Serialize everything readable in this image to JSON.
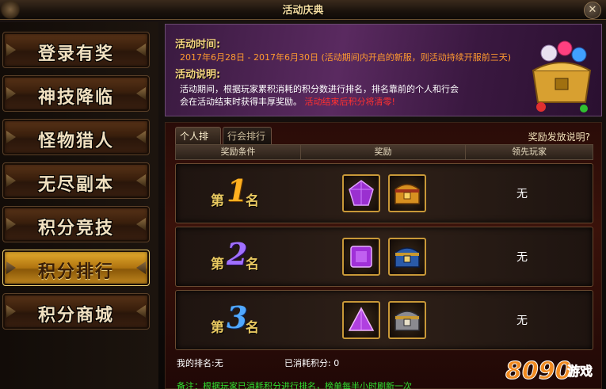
{
  "window": {
    "title": "活动庆典",
    "close_glyph": "✕"
  },
  "sidebar": {
    "items": [
      {
        "label": "登录有奖",
        "active": false
      },
      {
        "label": "神技降临",
        "active": false
      },
      {
        "label": "怪物猎人",
        "active": false
      },
      {
        "label": "无尽副本",
        "active": false
      },
      {
        "label": "积分竞技",
        "active": false
      },
      {
        "label": "积分排行",
        "active": true
      },
      {
        "label": "积分商城",
        "active": false
      }
    ]
  },
  "banner": {
    "time_heading": "活动时间:",
    "time_value": "2017年6月28日 - 2017年6月30日",
    "time_note": "(活动期间内开启的新服，则活动持续开服前三天)",
    "desc_heading": "活动说明:",
    "desc_line1": "活动期间，根据玩家累积消耗的积分数进行排名，排名靠前的个人和行会",
    "desc_line2": "会在活动结束时获得丰厚奖励。",
    "desc_warning": "活动结束后积分将清零!"
  },
  "panel": {
    "tabs": [
      {
        "label": "个人排行",
        "active": true
      },
      {
        "label": "行会排行",
        "active": false
      }
    ],
    "help_link": "奖励发放说明?",
    "columns": [
      "奖励条件",
      "奖励",
      "领先玩家"
    ],
    "rows": [
      {
        "prefix": "第",
        "rank": "1",
        "suffix": "名",
        "leader": "无",
        "rewards": [
          "purple-gem-icon",
          "golden-chest-icon"
        ]
      },
      {
        "prefix": "第",
        "rank": "2",
        "suffix": "名",
        "leader": "无",
        "rewards": [
          "purple-square-gem-icon",
          "blue-chest-icon"
        ]
      },
      {
        "prefix": "第",
        "rank": "3",
        "suffix": "名",
        "leader": "无",
        "rewards": [
          "purple-triangle-gem-icon",
          "silver-chest-icon"
        ]
      }
    ],
    "my_rank_label": "我的排名:",
    "my_rank_value": "无",
    "consumed_label": "已消耗积分:",
    "consumed_value": "0",
    "note": "备注：根据玩家已消耗积分进行排名，榜单每半小时刷新一次"
  },
  "watermark": {
    "text": "8090游戏"
  },
  "colors": {
    "accent_gold": "#f6d680",
    "warning_red": "#ff3030",
    "note_green": "#30e030"
  }
}
